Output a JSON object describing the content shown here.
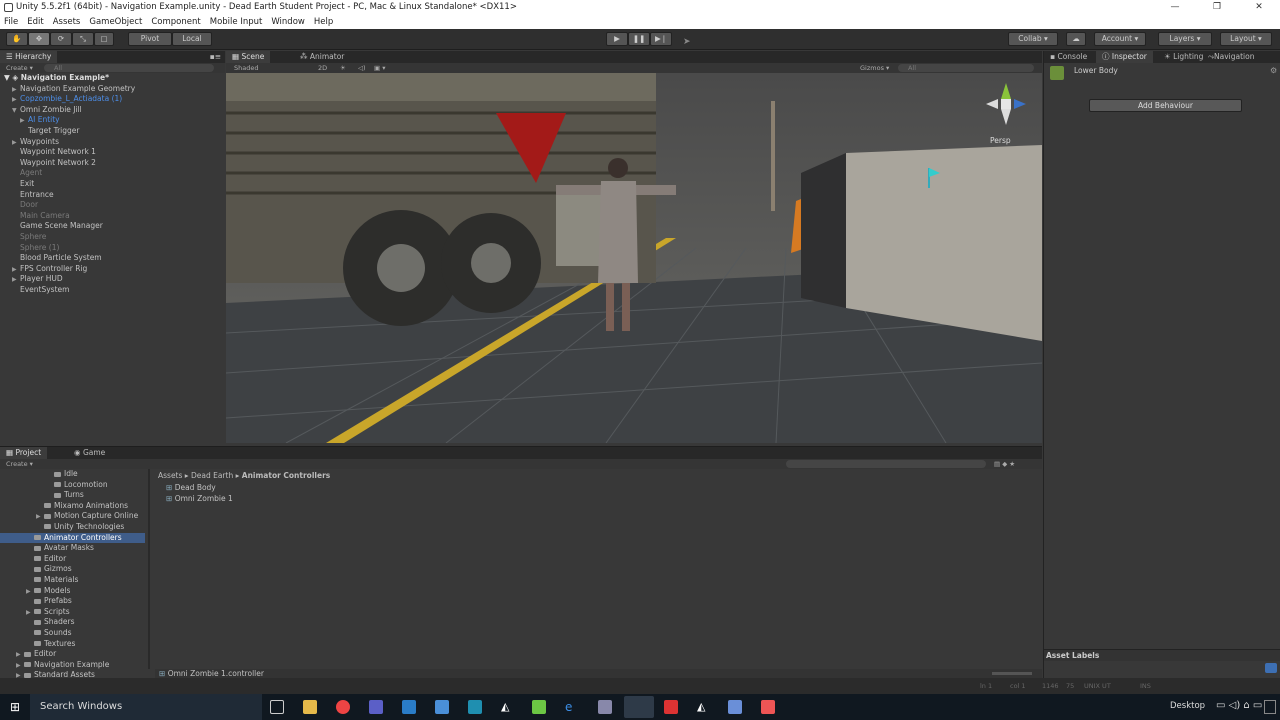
{
  "window": {
    "title": "Unity 5.5.2f1 (64bit) - Navigation Example.unity - Dead Earth Student Project - PC, Mac & Linux Standalone* <DX11>"
  },
  "menu": [
    "File",
    "Edit",
    "Assets",
    "GameObject",
    "Component",
    "Mobile Input",
    "Window",
    "Help"
  ],
  "toolbar": {
    "pivot": "Pivot",
    "local": "Local",
    "collab": "Collab ▾",
    "account": "Account ▾",
    "layers": "Layers ▾",
    "layout": "Layout ▾"
  },
  "hierarchy": {
    "tab": "Hierarchy",
    "create": "Create ▾",
    "search_placeholder": "All",
    "scene": "Navigation Example*",
    "items": [
      {
        "label": "Navigation Example Geometry",
        "indent": 1,
        "arrow": "▶",
        "style": ""
      },
      {
        "label": "Copzombie_L_Actiadata (1)",
        "indent": 1,
        "arrow": "▶",
        "style": "blue"
      },
      {
        "label": "Omni Zombie Jill",
        "indent": 1,
        "arrow": "▼",
        "style": ""
      },
      {
        "label": "AI Entity",
        "indent": 2,
        "arrow": "▶",
        "style": "blue"
      },
      {
        "label": "Target Trigger",
        "indent": 2,
        "arrow": "",
        "style": ""
      },
      {
        "label": "Waypoints",
        "indent": 1,
        "arrow": "▶",
        "style": ""
      },
      {
        "label": "Waypoint Network 1",
        "indent": 1,
        "arrow": "",
        "style": ""
      },
      {
        "label": "Waypoint Network 2",
        "indent": 1,
        "arrow": "",
        "style": ""
      },
      {
        "label": "Agent",
        "indent": 1,
        "arrow": "",
        "style": "dim"
      },
      {
        "label": "Exit",
        "indent": 1,
        "arrow": "",
        "style": ""
      },
      {
        "label": "Entrance",
        "indent": 1,
        "arrow": "",
        "style": ""
      },
      {
        "label": "Door",
        "indent": 1,
        "arrow": "",
        "style": "dim"
      },
      {
        "label": "Main Camera",
        "indent": 1,
        "arrow": "",
        "style": "dim"
      },
      {
        "label": "Game Scene Manager",
        "indent": 1,
        "arrow": "",
        "style": ""
      },
      {
        "label": "Sphere",
        "indent": 1,
        "arrow": "",
        "style": "dim"
      },
      {
        "label": "Sphere (1)",
        "indent": 1,
        "arrow": "",
        "style": "dim"
      },
      {
        "label": "Blood Particle System",
        "indent": 1,
        "arrow": "",
        "style": ""
      },
      {
        "label": "FPS Controller Rig",
        "indent": 1,
        "arrow": "▶",
        "style": ""
      },
      {
        "label": "Player HUD",
        "indent": 1,
        "arrow": "▶",
        "style": ""
      },
      {
        "label": "EventSystem",
        "indent": 1,
        "arrow": "",
        "style": ""
      }
    ]
  },
  "scene": {
    "tab_scene": "Scene",
    "tab_animator": "Animator",
    "shaded": "Shaded",
    "mode2d": "2D",
    "gizmos": "Gizmos ▾",
    "search_placeholder": "All",
    "persp": "Persp"
  },
  "inspector": {
    "tab_console": "Console",
    "tab_inspector": "Inspector",
    "tab_lighting": "Lighting",
    "tab_navigation": "Navigation",
    "object": "Lower Body",
    "add_behaviour": "Add Behaviour",
    "asset_labels": "Asset Labels"
  },
  "project": {
    "tab_project": "Project",
    "tab_game": "Game",
    "create": "Create ▾",
    "breadcrumb": [
      "Assets",
      "Dead Earth",
      "Animator Controllers"
    ],
    "tree": [
      {
        "label": "Idle",
        "indent": 4,
        "arrow": ""
      },
      {
        "label": "Locomotion",
        "indent": 4,
        "arrow": ""
      },
      {
        "label": "Turns",
        "indent": 4,
        "arrow": ""
      },
      {
        "label": "Mixamo Animations",
        "indent": 3,
        "arrow": ""
      },
      {
        "label": "Motion Capture Online",
        "indent": 3,
        "arrow": "▶"
      },
      {
        "label": "Unity Technologies",
        "indent": 3,
        "arrow": ""
      },
      {
        "label": "Animator Controllers",
        "indent": 2,
        "arrow": "",
        "sel": true
      },
      {
        "label": "Avatar Masks",
        "indent": 2,
        "arrow": ""
      },
      {
        "label": "Editor",
        "indent": 2,
        "arrow": ""
      },
      {
        "label": "Gizmos",
        "indent": 2,
        "arrow": ""
      },
      {
        "label": "Materials",
        "indent": 2,
        "arrow": ""
      },
      {
        "label": "Models",
        "indent": 2,
        "arrow": "▶"
      },
      {
        "label": "Prefabs",
        "indent": 2,
        "arrow": ""
      },
      {
        "label": "Scripts",
        "indent": 2,
        "arrow": "▶"
      },
      {
        "label": "Shaders",
        "indent": 2,
        "arrow": ""
      },
      {
        "label": "Sounds",
        "indent": 2,
        "arrow": ""
      },
      {
        "label": "Textures",
        "indent": 2,
        "arrow": ""
      },
      {
        "label": "Editor",
        "indent": 1,
        "arrow": "▶"
      },
      {
        "label": "Navigation Example",
        "indent": 1,
        "arrow": "▶"
      },
      {
        "label": "Standard Assets",
        "indent": 1,
        "arrow": "▶"
      }
    ],
    "files": [
      "Dead Body",
      "Omni Zombie 1"
    ],
    "status_file": "Omni Zombie 1.controller"
  },
  "statusbar": {
    "ln": "ln 1",
    "col": "col 1",
    "n1": "1146",
    "n2": "75",
    "enc": "UNIX UT",
    "ins": "INS"
  },
  "taskbar": {
    "search": "Search Windows",
    "desktop": "Desktop"
  },
  "colors": {
    "accent_selection": "#3f5d8a",
    "panel_bg": "#383838",
    "header_bg": "#282828",
    "link_blue": "#4d8ee8"
  }
}
